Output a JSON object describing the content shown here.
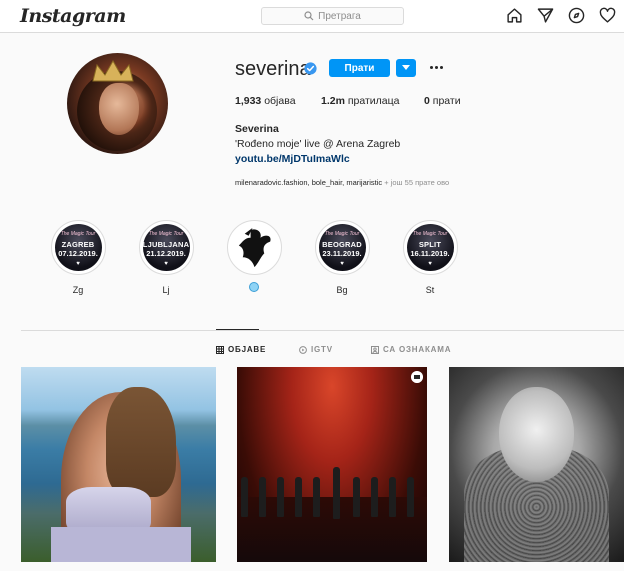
{
  "header": {
    "logo": "Instagram",
    "search_placeholder": "Претрага",
    "icons": [
      "home-icon",
      "direct-icon",
      "explore-icon",
      "activity-icon"
    ]
  },
  "profile": {
    "username": "severina",
    "verified": true,
    "follow_label": "Прати",
    "stats": {
      "posts_count": "1,933",
      "posts_label": "објава",
      "followers_count": "1.2m",
      "followers_label": "пратилаца",
      "following_count": "0",
      "following_label": "прати"
    },
    "bio": {
      "name": "Severina",
      "line1": "'Rođeno moje' live @ Arena Zagreb",
      "link": "youtu.be/MjDTuImaWlc"
    },
    "followed_by": {
      "names": "milenaradovic.fashion, bole_hair, marijaristic",
      "more": " + још 55 прате ово"
    }
  },
  "highlights": [
    {
      "tour": "The Magic Tour",
      "city": "ZAGREB",
      "date": "07.12.2019.",
      "label": "Zg"
    },
    {
      "tour": "The Magic Tour",
      "city": "LJUBLJANA",
      "date": "21.12.2019.",
      "label": "Lj"
    },
    {
      "tour": "",
      "city": "",
      "date": "",
      "label": ""
    },
    {
      "tour": "The Magic Tour",
      "city": "BEOGRAD",
      "date": "23.11.2019.",
      "label": "Bg"
    },
    {
      "tour": "The Magic Tour",
      "city": "SPLIT",
      "date": "16.11.2019.",
      "label": "St"
    }
  ],
  "tabs": [
    {
      "label": "ОБЈАВЕ",
      "icon": "grid-icon",
      "active": true
    },
    {
      "label": "IGTV",
      "icon": "igtv-icon",
      "active": false
    },
    {
      "label": "СА ОЗНАКАМА",
      "icon": "tagged-icon",
      "active": false
    }
  ],
  "colors": {
    "accent": "#0095f6",
    "link": "#00376b",
    "muted": "#8e8e8e",
    "border": "#dbdbdb"
  }
}
